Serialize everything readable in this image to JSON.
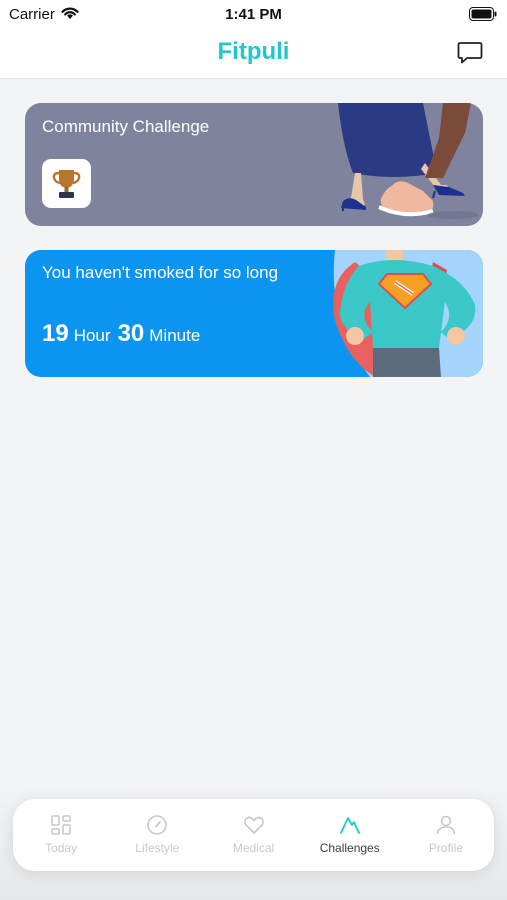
{
  "status_bar": {
    "carrier": "Carrier",
    "time": "1:41 PM"
  },
  "header": {
    "title": "Fitpuli",
    "chat_icon": "chat-bubble-icon"
  },
  "community_card": {
    "title": "Community Challenge",
    "icon": "trophy-icon"
  },
  "smoke_card": {
    "title": "You haven't smoked for so long",
    "hours": "19",
    "hours_unit": "Hour",
    "minutes": "30",
    "minutes_unit": "Minute"
  },
  "tabs": [
    {
      "label": "Today",
      "icon": "dashboard-icon",
      "active": false
    },
    {
      "label": "Lifestyle",
      "icon": "compass-icon",
      "active": false
    },
    {
      "label": "Medical",
      "icon": "heart-icon",
      "active": false
    },
    {
      "label": "Challenges",
      "icon": "mountain-icon",
      "active": true
    },
    {
      "label": "Profile",
      "icon": "user-icon",
      "active": false
    }
  ],
  "colors": {
    "brand": "#1fc9c9",
    "community_card": "#80839e",
    "smoke_card": "#0b95f0"
  }
}
